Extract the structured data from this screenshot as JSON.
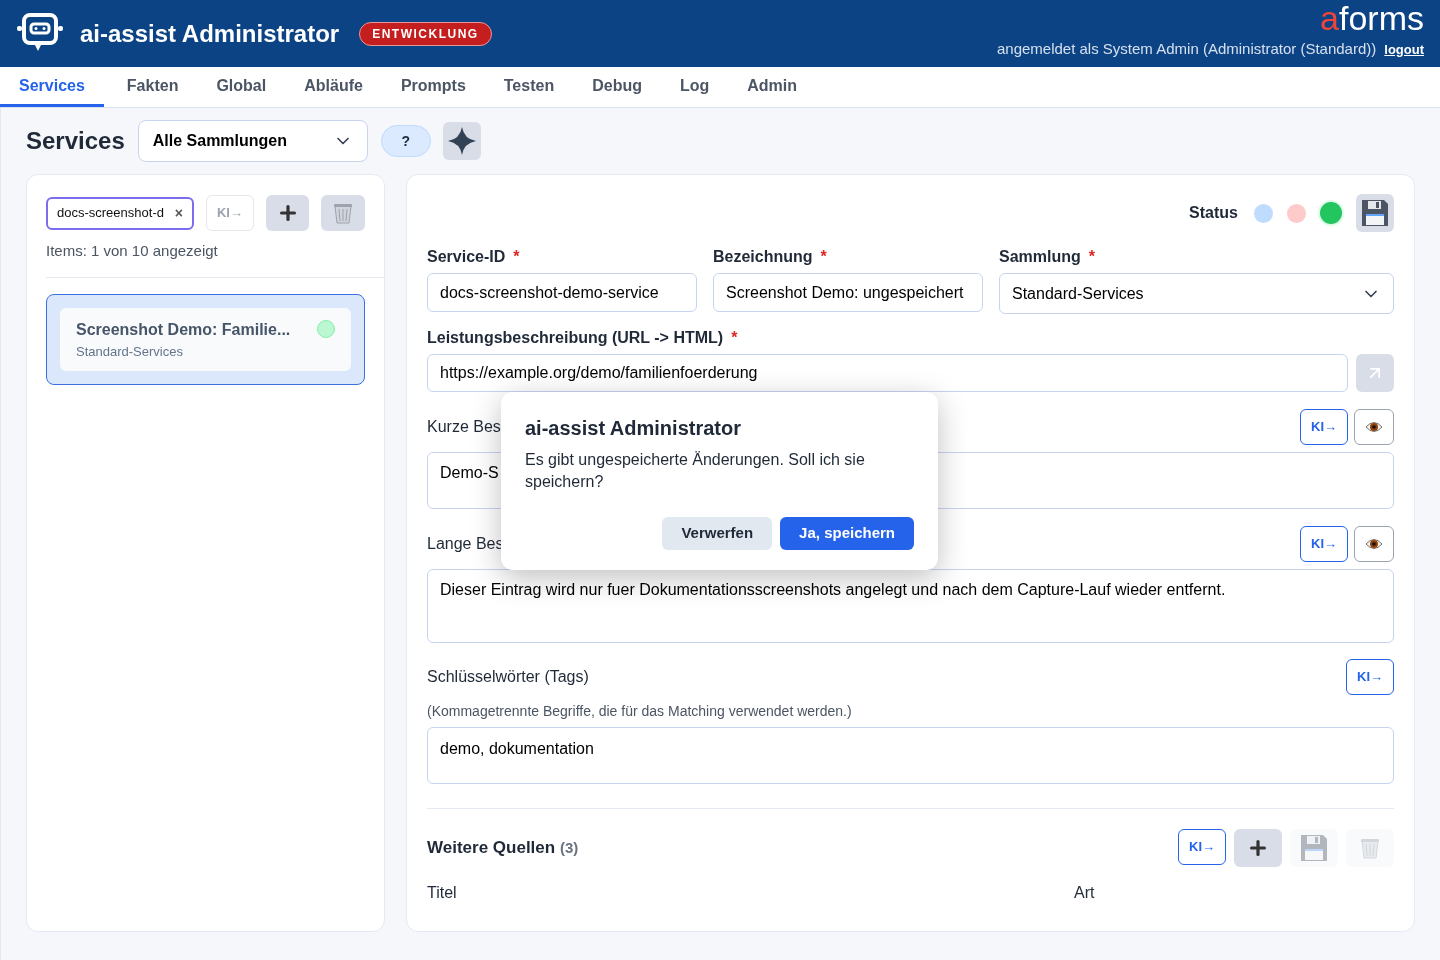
{
  "header": {
    "title": "ai-assist Administrator",
    "env_badge": "ENTWICKLUNG",
    "brand": "aforms",
    "user_info": "angemeldet als System Admin (Administrator (Standard))",
    "logout": "logout"
  },
  "tabs": [
    {
      "label": "Services",
      "selected": true
    },
    {
      "label": "Fakten",
      "selected": false
    },
    {
      "label": "Global",
      "selected": false
    },
    {
      "label": "Abläufe",
      "selected": false
    },
    {
      "label": "Prompts",
      "selected": false
    },
    {
      "label": "Testen",
      "selected": false
    },
    {
      "label": "Debug",
      "selected": false
    },
    {
      "label": "Log",
      "selected": false
    },
    {
      "label": "Admin",
      "selected": false
    }
  ],
  "toolbar": {
    "title": "Services",
    "collection": "Alle Sammlungen",
    "help": "?"
  },
  "sidebar": {
    "search": "docs-screenshot-d",
    "clear": "×",
    "ki_button": {
      "label": "KI→",
      "disabled": true
    },
    "count": "Items: 1 von 10 angezeigt",
    "items": [
      {
        "title": "Screenshot Demo: Familie...",
        "subtitle": "Standard-Services",
        "selected": true,
        "color": "#bbf7d0"
      }
    ]
  },
  "editor": {
    "status_label": "Status",
    "status_dots": [
      {
        "color": "#bfdbfe",
        "selected": false
      },
      {
        "color": "#fecaca",
        "selected": false
      },
      {
        "color": "#22c55e",
        "selected": true
      }
    ],
    "fields": [
      {
        "label": "Service-ID",
        "required": "*",
        "value": "docs-screenshot-demo-service"
      },
      {
        "label": "Bezeichnung",
        "required": "*",
        "value": "Screenshot Demo: ungespeichert"
      }
    ],
    "collection": {
      "label": "Sammlung",
      "required": "*",
      "value": "Standard-Services"
    },
    "url": {
      "label": "Leistungsbeschreibung (URL -> HTML)",
      "required": "*",
      "value": "https://example.org/demo/familienfoerderung"
    },
    "short": {
      "label": "Kurze Bes",
      "ki": "KI→",
      "value": "Demo-S"
    },
    "long": {
      "label": "Lange Bes",
      "ki": "KI→",
      "value": "Dieser Eintrag wird nur fuer Dokumentationsscreenshots angelegt und nach dem Capture-Lauf wieder entfernt."
    },
    "tags": {
      "label": "Schlüsselwörter (Tags)",
      "ki": "KI→",
      "hint": "(Kommagetrennte Begriffe, die für das Matching verwendet werden.)",
      "value": "demo, dokumentation"
    },
    "sources": {
      "title": "Weitere Quellen",
      "count": "(3)",
      "ki": "KI→",
      "save_disabled": true,
      "delete_disabled": true,
      "columns": [
        "Titel",
        "Art"
      ]
    }
  },
  "dialog": {
    "title": "ai-assist Administrator",
    "message": "Es gibt ungespeicherte Änderungen. Soll ich sie speichern?",
    "buttons": [
      {
        "label": "Verwerfen",
        "kind": "secondary"
      },
      {
        "label": "Ja, speichern",
        "kind": "primary"
      }
    ]
  }
}
